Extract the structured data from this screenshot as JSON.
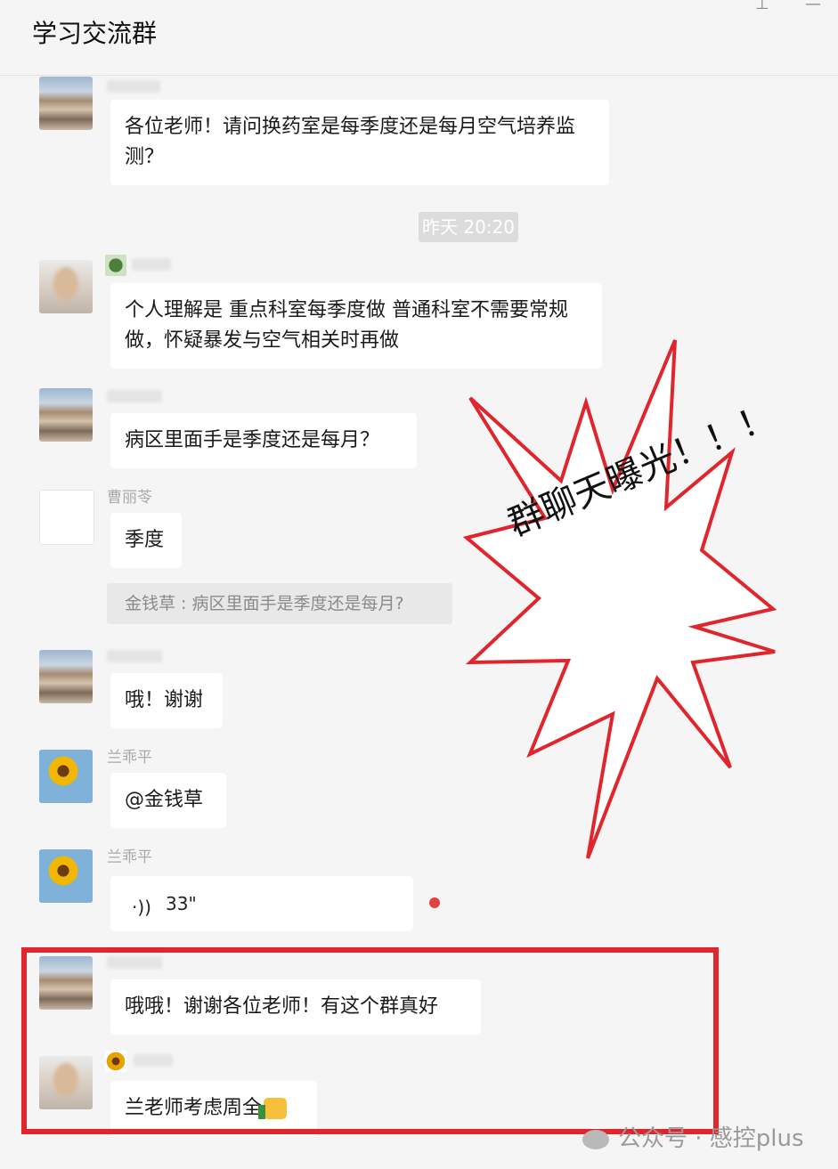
{
  "header": {
    "title": "学习交流群",
    "pin_icon": "pin-icon",
    "minimize_icon": "minimize-icon"
  },
  "messages": [
    {
      "text": "各位老师！请问换药室是每季度还是每月空气培养监测？"
    },
    {
      "text": "个人理解是 重点科室每季度做 普通科室不需要常规做，怀疑暴发与空气相关时再做"
    },
    {
      "text": "病区里面手是季度还是每月？"
    },
    {
      "sender": "曹丽苓",
      "text": "季度"
    },
    {
      "text": "哦！谢谢"
    },
    {
      "sender": "兰乖平",
      "text": "@金钱草"
    },
    {
      "sender": "兰乖平",
      "voice_duration": "33\""
    },
    {
      "text": "哦哦！谢谢各位老师！有这个群真好"
    },
    {
      "text": "兰老师考虑周全"
    }
  ],
  "timestamp": "昨天 20:20",
  "quote": "金钱草 : 病区里面手是季度还是每月?",
  "overlay": {
    "exclaim": "群聊天曝光！！！",
    "color": "#e0262c"
  },
  "watermark": "公众号 · 感控plus"
}
